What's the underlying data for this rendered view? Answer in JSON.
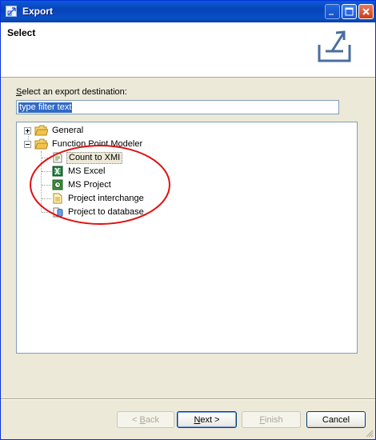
{
  "window": {
    "title": "Export",
    "title_icon": "export-wizard-icon",
    "controls": [
      "minimize-icon",
      "maximize-icon",
      "close-icon"
    ]
  },
  "banner": {
    "title": "Select",
    "icon": "export-tray-arrow-icon"
  },
  "filter": {
    "label": "Select an export destination:",
    "label_mnemonic": "S",
    "value": "type filter text"
  },
  "tree": {
    "items": [
      {
        "label": "General",
        "type": "folder",
        "expander": "collapsed",
        "level": 0
      },
      {
        "label": "Function Point Modeler",
        "type": "folder",
        "expander": "expanded",
        "level": 0
      },
      {
        "label": "Count to XMI",
        "type": "xmi-file",
        "level": 1,
        "selected": true
      },
      {
        "label": "MS Excel",
        "type": "excel",
        "level": 1
      },
      {
        "label": "MS Project",
        "type": "ms-project",
        "level": 1
      },
      {
        "label": "Project interchange",
        "type": "document",
        "level": 1
      },
      {
        "label": "Project to database",
        "type": "database",
        "level": 1
      }
    ],
    "annotation": {
      "shape": "ellipse",
      "color": "#e01010"
    }
  },
  "buttons": {
    "back": {
      "label": "< Back",
      "mnemonic": "B",
      "enabled": false
    },
    "next": {
      "label": "Next >",
      "mnemonic": "N",
      "enabled": true,
      "default": true
    },
    "finish": {
      "label": "Finish",
      "mnemonic": "F",
      "enabled": false
    },
    "cancel": {
      "label": "Cancel",
      "enabled": true
    }
  },
  "colors": {
    "titlebar": "#0842b8",
    "selection": "#316ac5",
    "window_bg": "#ece9d8",
    "folder": "#f2c14e"
  }
}
